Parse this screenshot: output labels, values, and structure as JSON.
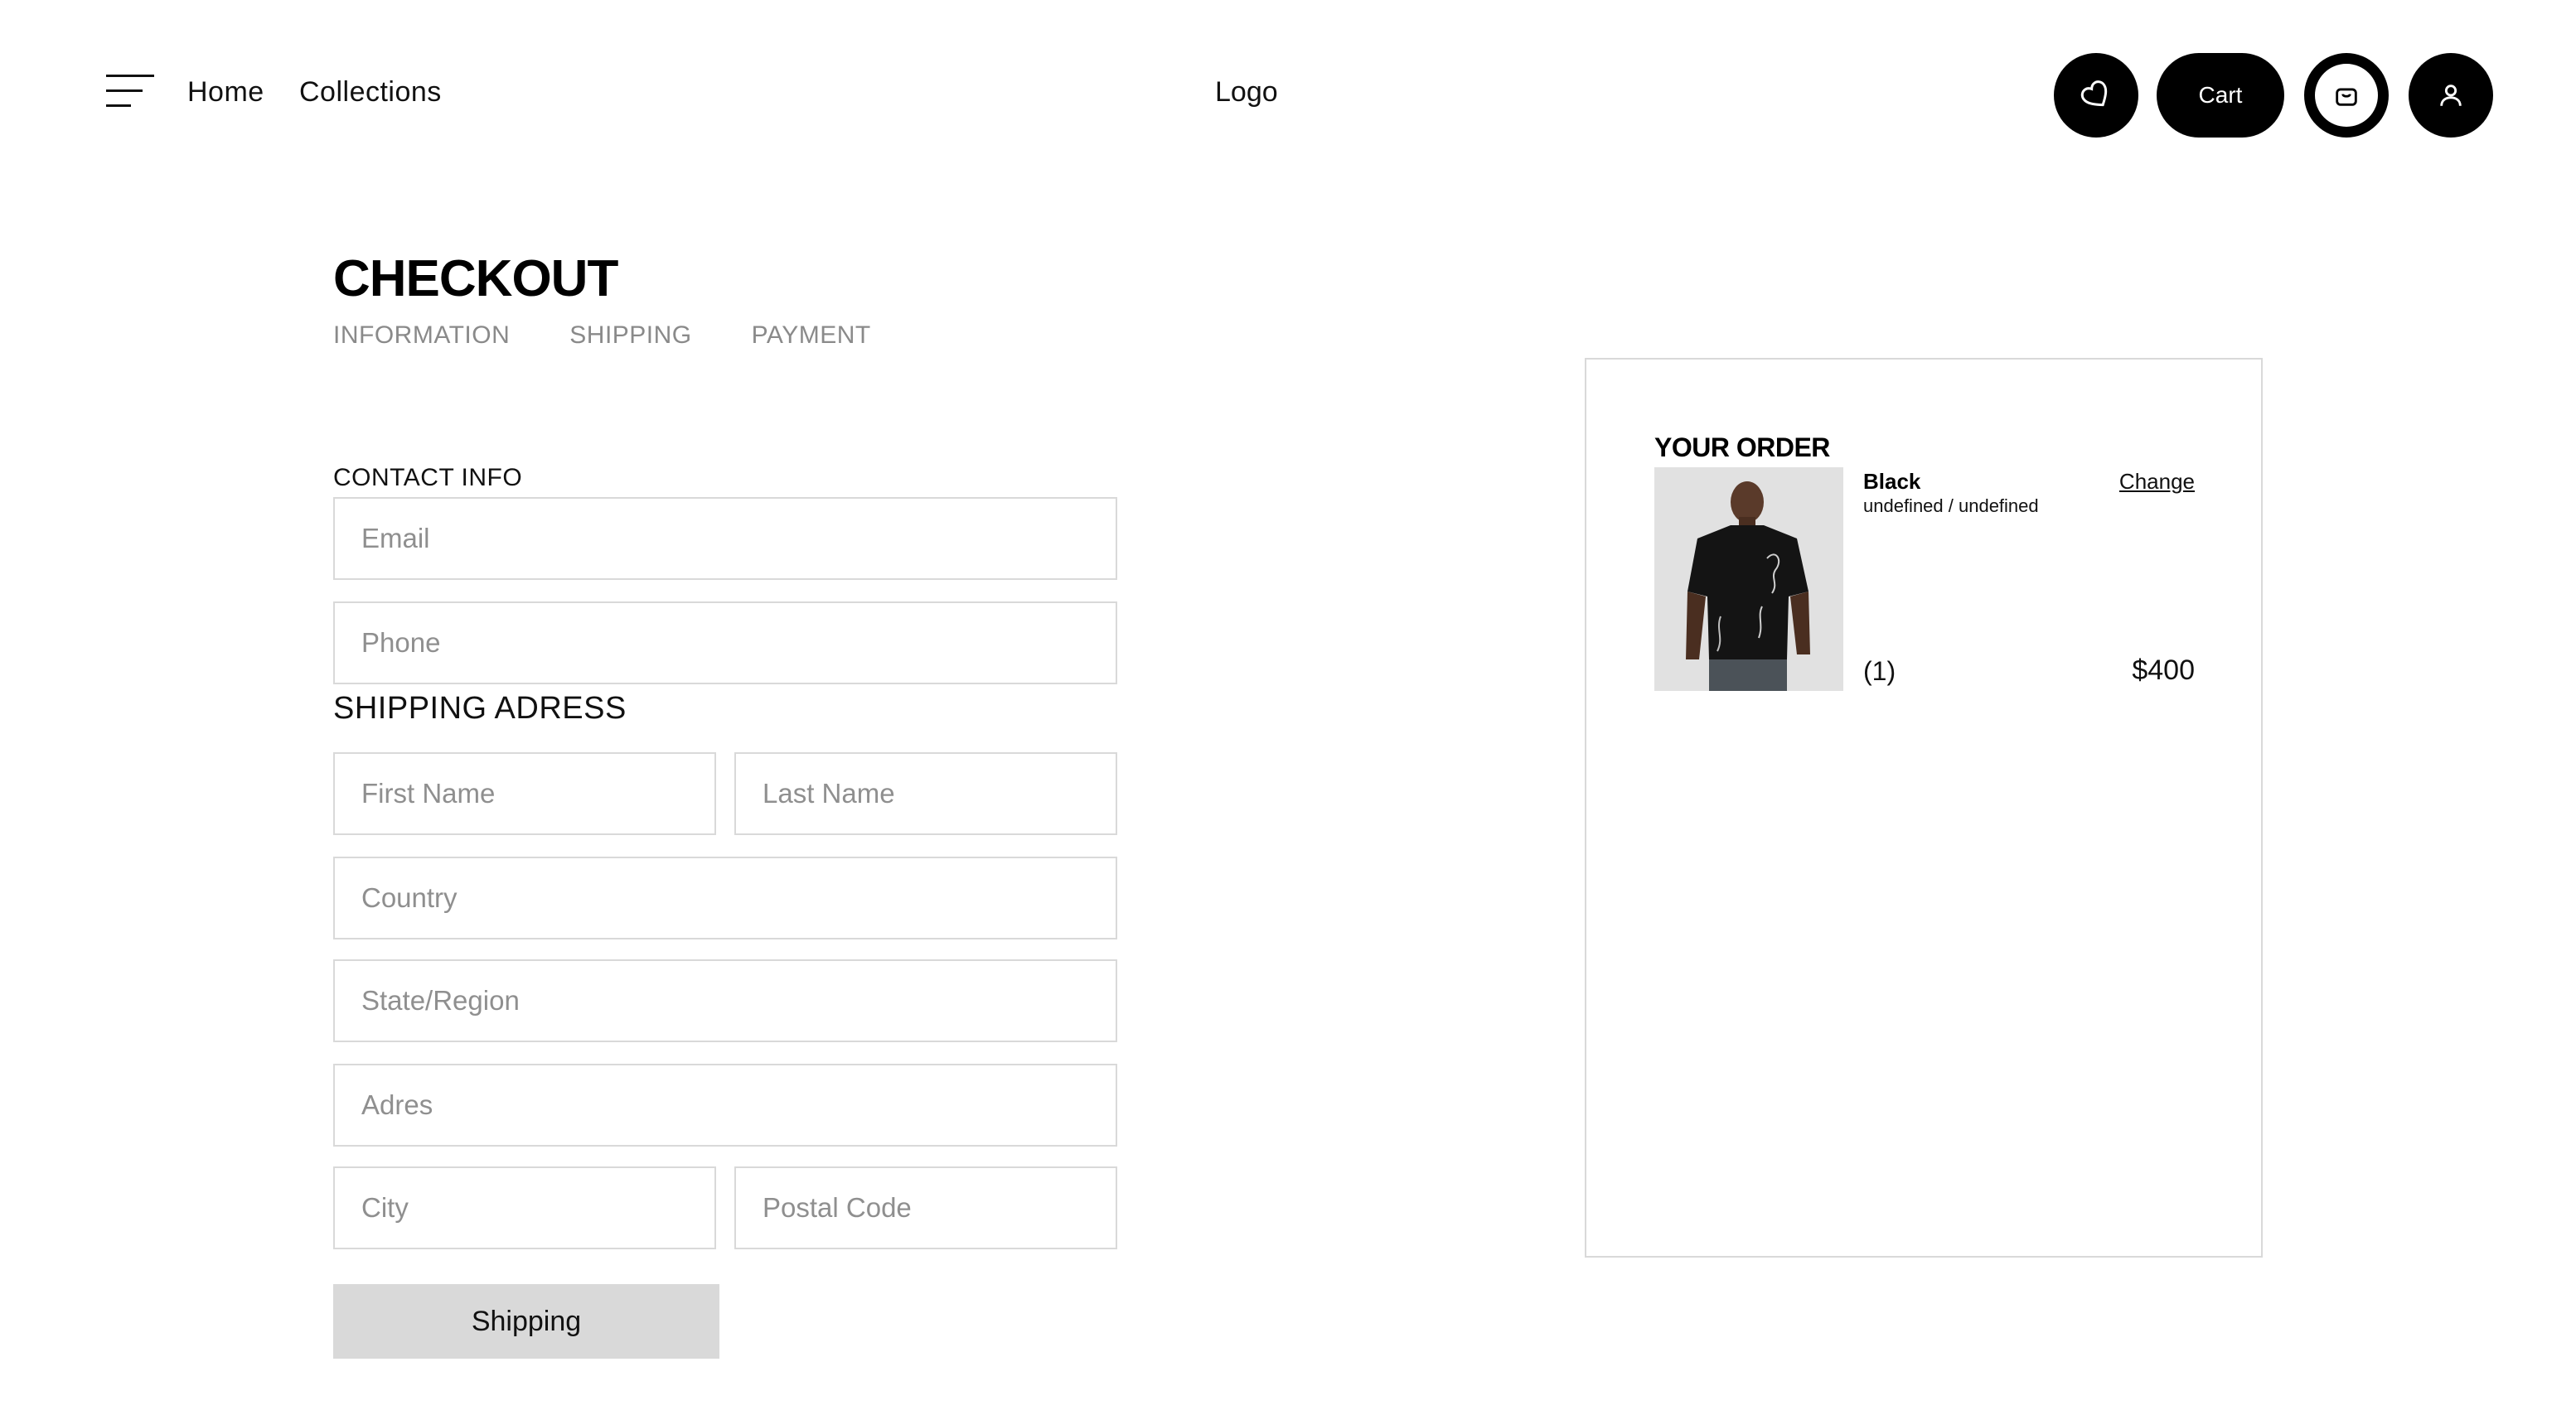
{
  "header": {
    "nav": {
      "home": "Home",
      "collections": "Collections"
    },
    "logo": "Logo",
    "cart_label": "Cart"
  },
  "checkout": {
    "title": "CHECKOUT",
    "steps": [
      "INFORMATION",
      "SHIPPING",
      "PAYMENT"
    ],
    "contact_label": "CONTACT INFO",
    "shipping_label": "SHIPPING ADRESS",
    "fields": {
      "email": {
        "placeholder": "Email",
        "value": ""
      },
      "phone": {
        "placeholder": "Phone",
        "value": ""
      },
      "first_name": {
        "placeholder": "First Name",
        "value": ""
      },
      "last_name": {
        "placeholder": "Last Name",
        "value": ""
      },
      "country": {
        "placeholder": "Country",
        "value": ""
      },
      "state": {
        "placeholder": "State/Region",
        "value": ""
      },
      "address": {
        "placeholder": "Adres",
        "value": ""
      },
      "city": {
        "placeholder": "City",
        "value": ""
      },
      "postal_code": {
        "placeholder": "Postal Code",
        "value": ""
      }
    },
    "submit_label": "Shipping"
  },
  "order": {
    "title": "YOUR ORDER",
    "item": {
      "name": "Black",
      "variant": "undefined / undefined",
      "change_label": "Change",
      "quantity": "(1)",
      "price": "$400",
      "image_icon": "black-tshirt-model-photo"
    }
  },
  "colors": {
    "accent": "#000000",
    "border": "#d9d9d9",
    "muted_text": "#8a8a8a",
    "button_bg": "#d9d9d9"
  }
}
